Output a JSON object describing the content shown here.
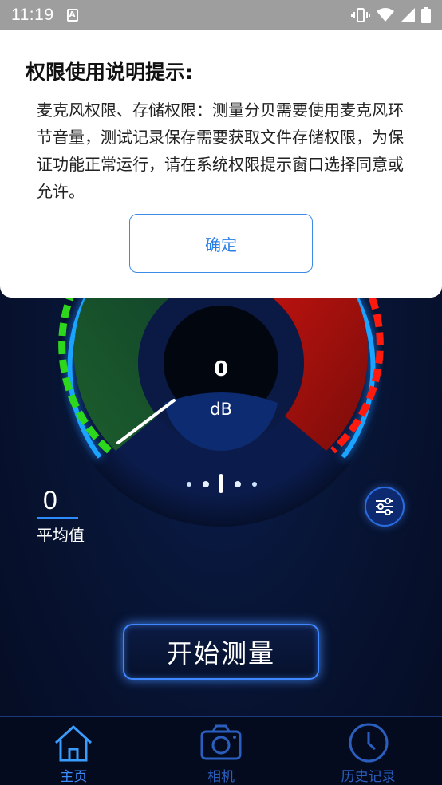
{
  "status_bar": {
    "time": "11:19",
    "notification_icon": "A"
  },
  "meter": {
    "current_value": "0",
    "unit": "dB",
    "needle_position": 0
  },
  "average": {
    "value": "0",
    "label": "平均值"
  },
  "start_button": {
    "label": "开始测量"
  },
  "bottom_nav": {
    "items": [
      {
        "label": "主页",
        "icon": "home-icon",
        "active": true
      },
      {
        "label": "相机",
        "icon": "camera-icon",
        "active": false
      },
      {
        "label": "历史记录",
        "icon": "clock-icon",
        "active": false
      }
    ]
  },
  "dialog": {
    "title": "权限使用说明提示:",
    "body": "麦克风权限、存储权限：测量分贝需要使用麦克风环节音量，测试记录保存需要获取文件存储权限，为保证功能正常运行，请在系统权限提示窗口选择同意或允许。",
    "confirm_label": "确定"
  },
  "colors": {
    "accent": "#2b7fff",
    "gauge_low": "#2dd81c",
    "gauge_high": "#ff1a0e"
  }
}
